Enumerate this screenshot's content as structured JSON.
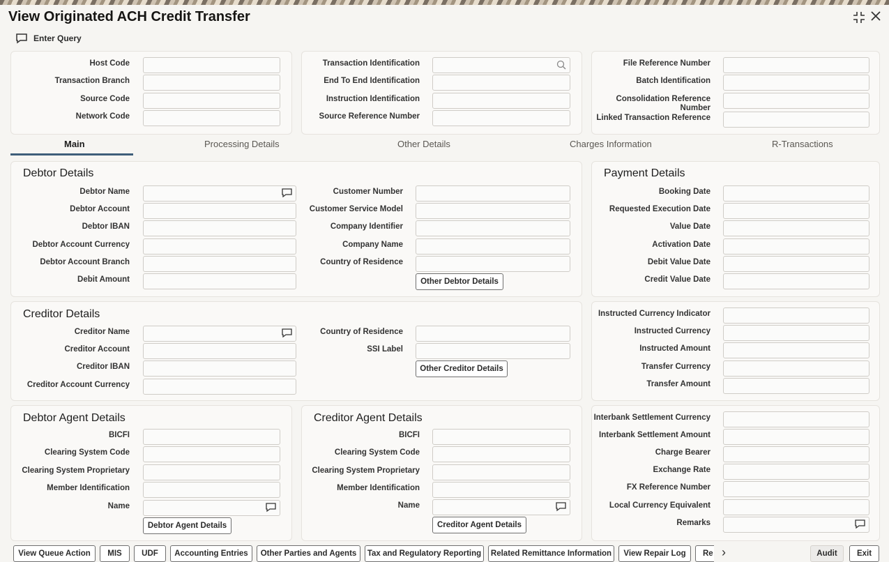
{
  "window": {
    "title": "View Originated ACH Credit Transfer"
  },
  "toolbar": {
    "enter_query": "Enter Query"
  },
  "header": {
    "col1": [
      "Host Code",
      "Transaction Branch",
      "Source Code",
      "Network Code"
    ],
    "col2": [
      "Transaction Identification",
      "End To End Identification",
      "Instruction Identification",
      "Source Reference Number"
    ],
    "col3": [
      "File Reference Number",
      "Batch Identification",
      "Consolidation Reference",
      "Number",
      "Linked Transaction Reference"
    ]
  },
  "tabs": [
    "Main",
    "Processing Details",
    "Other Details",
    "Charges Information",
    "R-Transactions"
  ],
  "debtor": {
    "title": "Debtor Details",
    "left": [
      "Debtor Name",
      "Debtor Account",
      "Debtor IBAN",
      "Debtor Account Currency",
      "Debtor Account Branch",
      "Debit Amount"
    ],
    "right": [
      "Customer Number",
      "Customer Service Model",
      "Company Identifier",
      "Company Name",
      "Country of Residence"
    ],
    "button": "Other Debtor Details"
  },
  "payment": {
    "title": "Payment Details",
    "labels": [
      "Booking Date",
      "Requested Execution Date",
      "Value Date",
      "Activation Date",
      "Debit Value Date",
      "Credit Value Date"
    ]
  },
  "creditor": {
    "title": "Creditor Details",
    "left": [
      "Creditor Name",
      "Creditor Account",
      "Creditor IBAN",
      "Creditor Account Currency"
    ],
    "right": [
      "Country of Residence",
      "SSI Label"
    ],
    "button": "Other Creditor Details"
  },
  "instructed": {
    "labels": [
      "Instructed Currency Indicator",
      "Instructed Currency",
      "Instructed Amount",
      "Transfer Currency",
      "Transfer Amount"
    ]
  },
  "debtor_agent": {
    "title": "Debtor Agent Details",
    "labels": [
      "BICFI",
      "Clearing System Code",
      "Clearing System Proprietary",
      "Member Identification",
      "Name"
    ],
    "button": "Debtor Agent Details"
  },
  "creditor_agent": {
    "title": "Creditor Agent Details",
    "labels": [
      "BICFI",
      "Clearing System Code",
      "Clearing System Proprietary",
      "Member Identification",
      "Name"
    ],
    "button": "Creditor Agent Details"
  },
  "settlement": {
    "labels": [
      "Interbank Settlement Currency",
      "Interbank Settlement Amount",
      "Charge Bearer",
      "Exchange Rate",
      "FX Reference Number",
      "Local Currency Equivalent",
      "Remarks"
    ]
  },
  "footer": {
    "buttons": [
      "View Queue Action",
      "MIS",
      "UDF",
      "Accounting Entries",
      "Other Parties and Agents",
      "Tax and Regulatory Reporting",
      "Related Remittance Information",
      "View Repair Log",
      "Re"
    ],
    "more": "›",
    "audit": "Audit",
    "exit": "Exit"
  }
}
